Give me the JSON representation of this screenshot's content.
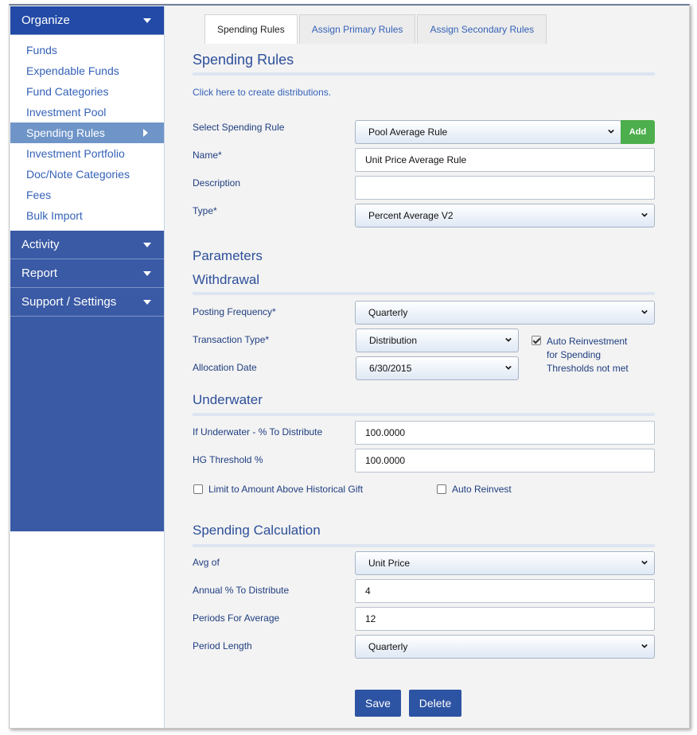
{
  "sidebar": {
    "organize": "Organize",
    "items": [
      {
        "label": "Funds"
      },
      {
        "label": "Expendable Funds"
      },
      {
        "label": "Fund Categories"
      },
      {
        "label": "Investment Pool"
      },
      {
        "label": "Spending Rules"
      },
      {
        "label": "Investment Portfolio"
      },
      {
        "label": "Doc/Note Categories"
      },
      {
        "label": "Fees"
      },
      {
        "label": "Bulk Import"
      }
    ],
    "activity": "Activity",
    "report": "Report",
    "support": "Support / Settings"
  },
  "tabs": [
    "Spending Rules",
    "Assign Primary Rules",
    "Assign Secondary Rules"
  ],
  "page_title": "Spending Rules",
  "create_link": "Click here to create distributions.",
  "form": {
    "select_rule_label": "Select Spending Rule",
    "select_rule_value": "Pool Average Rule",
    "add_label": "Add",
    "name_label": "Name*",
    "name_value": "Unit Price Average Rule",
    "description_label": "Description",
    "description_value": "",
    "type_label": "Type*",
    "type_value": "Percent Average V2"
  },
  "parameters": {
    "title": "Parameters",
    "withdrawal_title": "Withdrawal",
    "posting_frequency_label": "Posting Frequency*",
    "posting_frequency_value": "Quarterly",
    "transaction_type_label": "Transaction Type*",
    "transaction_type_value": "Distribution",
    "allocation_date_label": "Allocation Date",
    "allocation_date_value": "6/30/2015",
    "auto_reinvest_line1": "Auto Reinvestment",
    "auto_reinvest_line2": "for Spending",
    "auto_reinvest_line3": "Thresholds not met",
    "auto_reinvest_checked": true
  },
  "underwater": {
    "title": "Underwater",
    "pct_label": "If Underwater - % To Distribute",
    "pct_value": "100.0000",
    "hg_label": "HG Threshold %",
    "hg_value": "100.0000",
    "limit_label": "Limit to Amount Above Historical Gift",
    "limit_checked": false,
    "auto_reinvest_label": "Auto Reinvest",
    "auto_reinvest_checked": false
  },
  "calculation": {
    "title": "Spending Calculation",
    "avg_of_label": "Avg of",
    "avg_of_value": "Unit Price",
    "annual_label": "Annual % To Distribute",
    "annual_value": "4",
    "periods_label": "Periods For Average",
    "periods_value": "12",
    "period_length_label": "Period Length",
    "period_length_value": "Quarterly"
  },
  "buttons": {
    "save": "Save",
    "delete": "Delete"
  },
  "colors": {
    "sidebar_head": "#224aa6",
    "sidebar_sub": "#3a5aa5",
    "active_item": "#6f95c8",
    "add_button": "#4cae4c",
    "primary_button": "#2d53a3"
  }
}
